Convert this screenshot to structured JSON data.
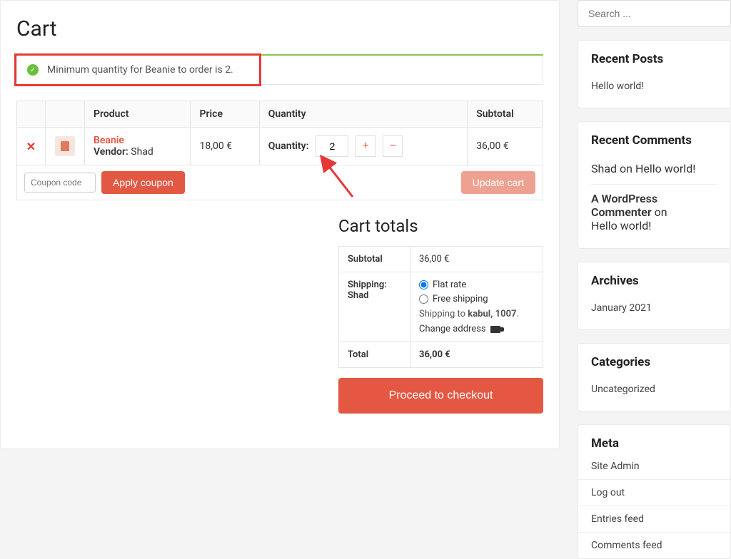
{
  "page": {
    "title": "Cart"
  },
  "notice": {
    "text": "Minimum quantity for Beanie to order is 2."
  },
  "cart_table": {
    "headers": {
      "product": "Product",
      "price": "Price",
      "quantity": "Quantity",
      "subtotal": "Subtotal"
    },
    "row": {
      "product_name": "Beanie",
      "vendor_label": "Vendor:",
      "vendor_name": "Shad",
      "price": "18,00 €",
      "qty_label": "Quantity:",
      "qty_value": "2",
      "subtotal": "36,00 €"
    },
    "coupon_placeholder": "Coupon code",
    "apply_coupon": "Apply coupon",
    "update_cart": "Update cart"
  },
  "totals": {
    "title": "Cart totals",
    "subtotal_label": "Subtotal",
    "subtotal_value": "36,00 €",
    "shipping_label": "Shipping:",
    "shipping_vendor": "Shad",
    "flat_rate": "Flat rate",
    "free_shipping": "Free shipping",
    "shipping_to_prefix": "Shipping to ",
    "shipping_to_dest": "kabul, 1007",
    "shipping_to_suffix": ".",
    "change_address": "Change address",
    "total_label": "Total",
    "total_value": "36,00 €",
    "checkout": "Proceed to checkout"
  },
  "sidebar": {
    "search_placeholder": "Search ...",
    "recent_posts": {
      "title": "Recent Posts",
      "items": [
        "Hello world!"
      ]
    },
    "recent_comments": {
      "title": "Recent Comments",
      "items": [
        {
          "author": "Shad",
          "on": " on ",
          "post": "Hello world!"
        },
        {
          "author": "A WordPress Commenter",
          "on": " on ",
          "post": "Hello world!"
        }
      ]
    },
    "archives": {
      "title": "Archives",
      "items": [
        "January 2021"
      ]
    },
    "categories": {
      "title": "Categories",
      "items": [
        "Uncategorized"
      ]
    },
    "meta": {
      "title": "Meta",
      "items": [
        "Site Admin",
        "Log out",
        "Entries feed",
        "Comments feed"
      ]
    }
  }
}
